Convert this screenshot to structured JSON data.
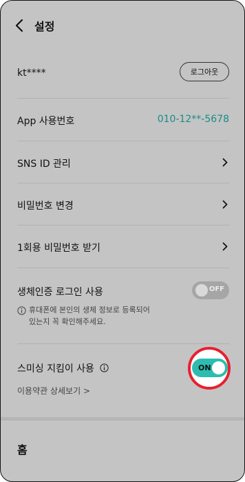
{
  "header": {
    "title": "설정"
  },
  "account": {
    "id": "kt****",
    "logout_label": "로그아웃"
  },
  "app_number": {
    "label": "App 사용번호",
    "value": "010-12**-5678"
  },
  "menu": [
    {
      "label": "SNS ID 관리"
    },
    {
      "label": "비밀번호 변경"
    },
    {
      "label": "1회용 비밀번호 받기"
    }
  ],
  "biometric": {
    "label": "생체인증 로그인 사용",
    "toggle_label": "OFF",
    "note_line1": "휴대폰에 본인의 생체 정보로 등록되어",
    "note_line2": "있는지 꼭 확인해주세요."
  },
  "smishing": {
    "label": "스미싱 지킴이 사용",
    "toggle_label": "ON",
    "terms_link": "이용약관 상세보기 >"
  },
  "footer": {
    "home_label": "홈"
  },
  "colors": {
    "accent": "#2dbdb0",
    "highlight_ring": "#e8202d",
    "phone_number": "#1a8b86"
  },
  "icons": [
    "back-arrow-icon",
    "chevron-right-icon",
    "info-icon"
  ]
}
